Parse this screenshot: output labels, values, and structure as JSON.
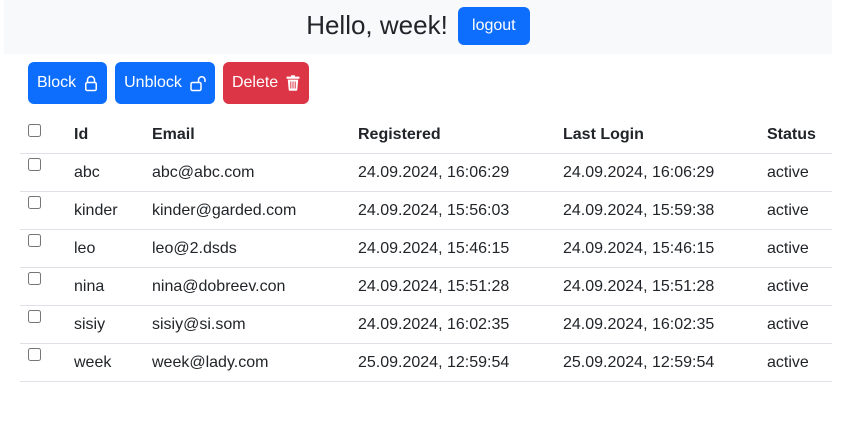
{
  "header": {
    "greeting": "Hello, week!",
    "logout_label": "logout"
  },
  "toolbar": {
    "block_label": "Block",
    "unblock_label": "Unblock",
    "delete_label": "Delete"
  },
  "table": {
    "columns": [
      "Id",
      "Email",
      "Registered",
      "Last Login",
      "Status"
    ],
    "rows": [
      {
        "id": "abc",
        "email": "abc@abc.com",
        "registered": "24.09.2024, 16:06:29",
        "last_login": "24.09.2024, 16:06:29",
        "status": "active"
      },
      {
        "id": "kinder",
        "email": "kinder@garded.com",
        "registered": "24.09.2024, 15:56:03",
        "last_login": "24.09.2024, 15:59:38",
        "status": "active"
      },
      {
        "id": "leo",
        "email": "leo@2.dsds",
        "registered": "24.09.2024, 15:46:15",
        "last_login": "24.09.2024, 15:46:15",
        "status": "active"
      },
      {
        "id": "nina",
        "email": "nina@dobreev.con",
        "registered": "24.09.2024, 15:51:28",
        "last_login": "24.09.2024, 15:51:28",
        "status": "active"
      },
      {
        "id": "sisiy",
        "email": "sisiy@si.som",
        "registered": "24.09.2024, 16:02:35",
        "last_login": "24.09.2024, 16:02:35",
        "status": "active"
      },
      {
        "id": "week",
        "email": "week@lady.com",
        "registered": "25.09.2024, 12:59:54",
        "last_login": "25.09.2024, 12:59:54",
        "status": "active"
      }
    ]
  },
  "icons": {
    "block": "lock-icon",
    "unblock": "unlock-icon",
    "delete": "trash-icon"
  },
  "colors": {
    "primary": "#0d6efd",
    "danger": "#dc3545",
    "header_bg": "#f8f9fa"
  }
}
